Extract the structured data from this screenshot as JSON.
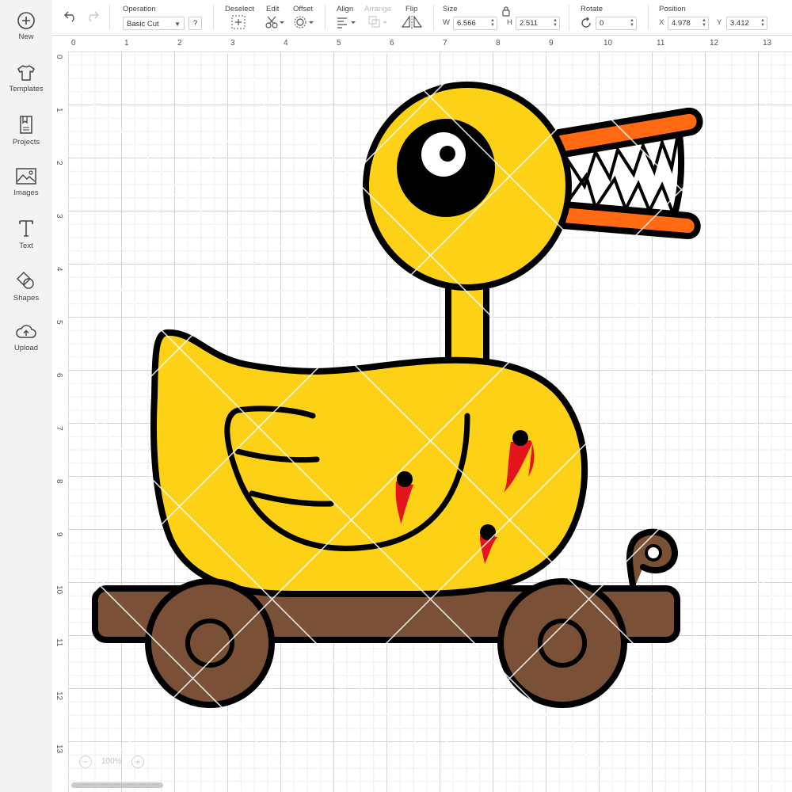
{
  "sidebar": {
    "items": [
      {
        "label": "New",
        "icon": "plus-circle-icon"
      },
      {
        "label": "Templates",
        "icon": "tshirt-icon"
      },
      {
        "label": "Projects",
        "icon": "bookmark-book-icon"
      },
      {
        "label": "Images",
        "icon": "image-icon"
      },
      {
        "label": "Text",
        "icon": "text-t-icon"
      },
      {
        "label": "Shapes",
        "icon": "shapes-icon"
      },
      {
        "label": "Upload",
        "icon": "cloud-upload-icon"
      }
    ]
  },
  "toolbar": {
    "operation_label": "Operation",
    "operation_value": "Basic Cut",
    "help_label": "?",
    "deselect_label": "Deselect",
    "edit_label": "Edit",
    "offset_label": "Offset",
    "align_label": "Align",
    "arrange_label": "Arrange",
    "flip_label": "Flip",
    "size_label": "Size",
    "width_tag": "W",
    "width_value": "6.566",
    "height_tag": "H",
    "height_value": "2.511",
    "rotate_label": "Rotate",
    "rotate_value": "0",
    "position_label": "Position",
    "x_tag": "X",
    "x_value": "4.978",
    "y_tag": "Y",
    "y_value": "3.412"
  },
  "ruler": {
    "top": [
      "0",
      "1",
      "2",
      "3",
      "4",
      "5",
      "6",
      "7",
      "8",
      "9",
      "10",
      "11",
      "12",
      "13"
    ],
    "left": [
      "0",
      "1",
      "2",
      "3",
      "4",
      "5",
      "6",
      "7",
      "8",
      "9",
      "10",
      "11",
      "12",
      "13"
    ]
  },
  "canvas": {
    "zoom_label": "100%"
  },
  "colors": {
    "duck_yellow": "#FCD116",
    "beak_orange": "#FF6A13",
    "wood_brown": "#7A5136",
    "blood_red": "#E3141B",
    "outline": "#000000"
  }
}
